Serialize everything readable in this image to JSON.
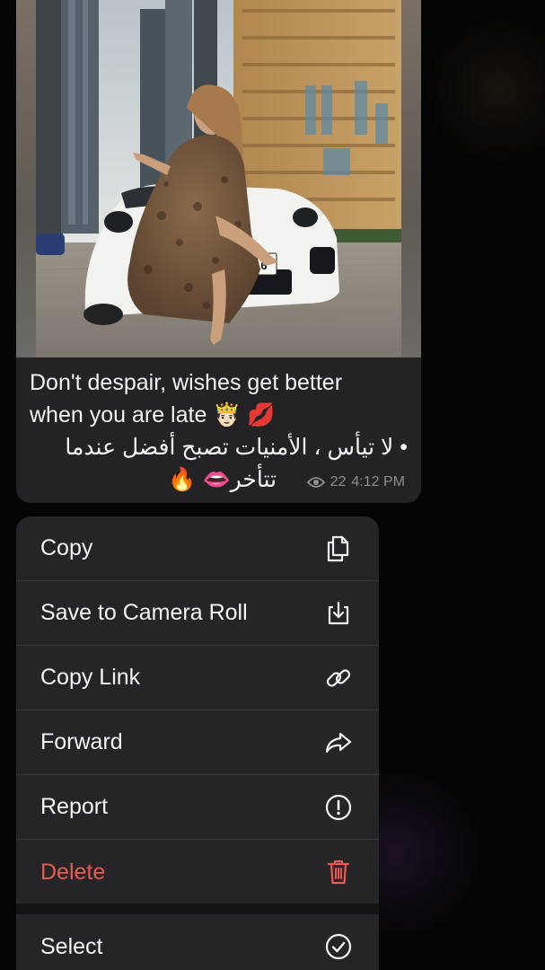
{
  "message": {
    "caption_line_1": "Don't despair, wishes get better",
    "caption_line_2": "when you are late 🤴🏻 💋",
    "caption_arabic_1": "• لا تيأس ، الأمنيات تصبح أفضل عندما",
    "caption_arabic_2": "تتأخر👄 🔥",
    "views": "22",
    "time": "4:12 PM",
    "plate_number": "3316"
  },
  "menu": {
    "items": [
      {
        "label": "Copy",
        "icon": "copy-icon"
      },
      {
        "label": "Save to Camera Roll",
        "icon": "save-download-icon"
      },
      {
        "label": "Copy Link",
        "icon": "link-icon"
      },
      {
        "label": "Forward",
        "icon": "forward-arrow-icon"
      },
      {
        "label": "Report",
        "icon": "exclamation-circle-icon"
      },
      {
        "label": "Delete",
        "icon": "trash-icon",
        "destructive": true
      },
      {
        "label": "Select",
        "icon": "checkmark-circle-icon"
      }
    ]
  },
  "colors": {
    "bubble": "#232325",
    "menu": "#252527",
    "destructive": "#ea5a4f",
    "meta": "#8e8e93"
  }
}
